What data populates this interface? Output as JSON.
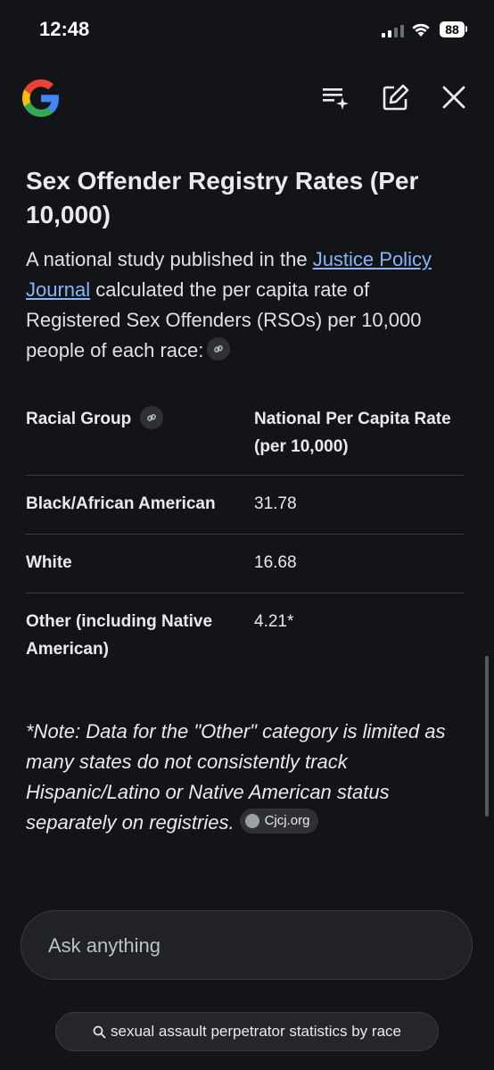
{
  "status": {
    "time": "12:48",
    "battery": "88"
  },
  "header": {
    "logo_icon": "google-g-icon",
    "icons": [
      "playlist-sparkle-icon",
      "edit-icon",
      "close-icon"
    ]
  },
  "content": {
    "title": "Sex Offender Registry Rates (Per 10,000)",
    "intro_before": "A national study published in the ",
    "intro_link": "Justice Policy Journal",
    "intro_after": " calculated the per capita rate of Registered Sex Offenders (RSOs) per 10,000 people of each race:",
    "table": {
      "headers": [
        "Racial Group",
        "National Per Capita Rate (per 10,000)"
      ],
      "rows": [
        {
          "group": "Black/African American",
          "rate": "31.78"
        },
        {
          "group": "White",
          "rate": "16.68"
        },
        {
          "group": "Other (including Native American)",
          "rate": "4.21*"
        }
      ]
    },
    "note": "*Note: Data for the \"Other\" category is limited as many states do not consistently track Hispanic/Latino or Native American status separately on registries.",
    "source_label": "Cjcj.org"
  },
  "composer": {
    "placeholder": "Ask anything"
  },
  "suggestion": {
    "label": "sexual assault perpetrator statistics by race"
  },
  "colors": {
    "background": "#131418",
    "link": "#8ab4f8",
    "chip": "#2e3034"
  }
}
